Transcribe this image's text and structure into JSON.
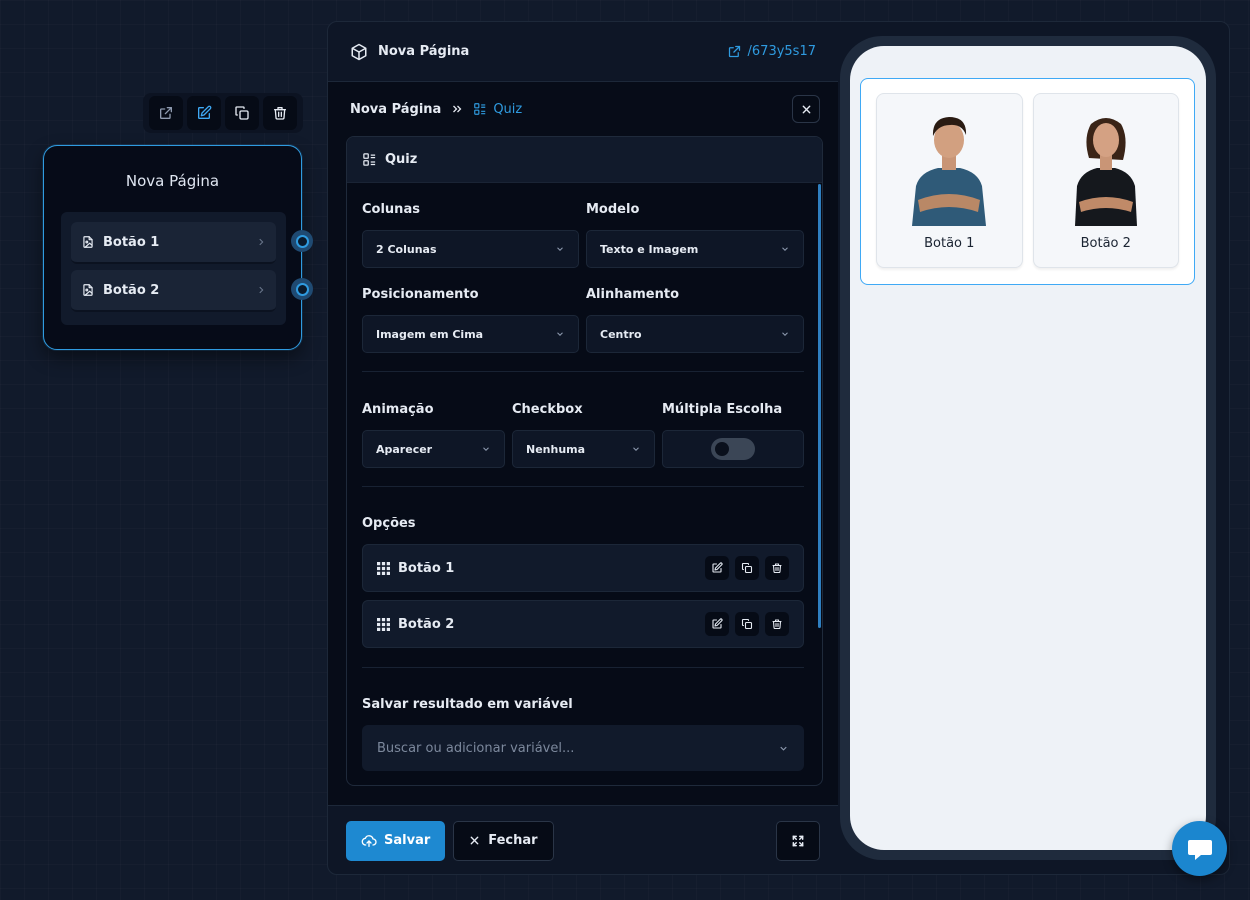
{
  "node": {
    "title": "Nova Página",
    "items": [
      {
        "label": "Botão 1"
      },
      {
        "label": "Botão 2"
      }
    ],
    "toolbar": [
      "external-link-icon",
      "edit-icon",
      "copy-icon",
      "trash-icon"
    ]
  },
  "panel": {
    "header_title": "Nova Página",
    "page_link": "/673y5s17",
    "breadcrumb": {
      "parent": "Nova Página",
      "current": "Quiz"
    },
    "section_title": "Quiz"
  },
  "form": {
    "colunas": {
      "label": "Colunas",
      "value": "2 Colunas"
    },
    "modelo": {
      "label": "Modelo",
      "value": "Texto e Imagem"
    },
    "posicionamento": {
      "label": "Posicionamento",
      "value": "Imagem em Cima"
    },
    "alinhamento": {
      "label": "Alinhamento",
      "value": "Centro"
    },
    "animacao": {
      "label": "Animação",
      "value": "Aparecer"
    },
    "checkbox": {
      "label": "Checkbox",
      "value": "Nenhuma"
    },
    "multipla": {
      "label": "Múltipla Escolha",
      "enabled": false
    },
    "opcoes_label": "Opções",
    "opcoes": [
      {
        "label": "Botão 1"
      },
      {
        "label": "Botão 2"
      }
    ],
    "variavel": {
      "label": "Salvar resultado em variável",
      "placeholder": "Buscar ou adicionar variável..."
    }
  },
  "footer": {
    "save": "Salvar",
    "close": "Fechar"
  },
  "preview": {
    "cards": [
      {
        "caption": "Botão 1",
        "shirt": "#2f5a78"
      },
      {
        "caption": "Botão 2",
        "shirt": "#15181d"
      }
    ]
  },
  "colors": {
    "accent": "#2f9be0",
    "background": "#111a2b"
  }
}
